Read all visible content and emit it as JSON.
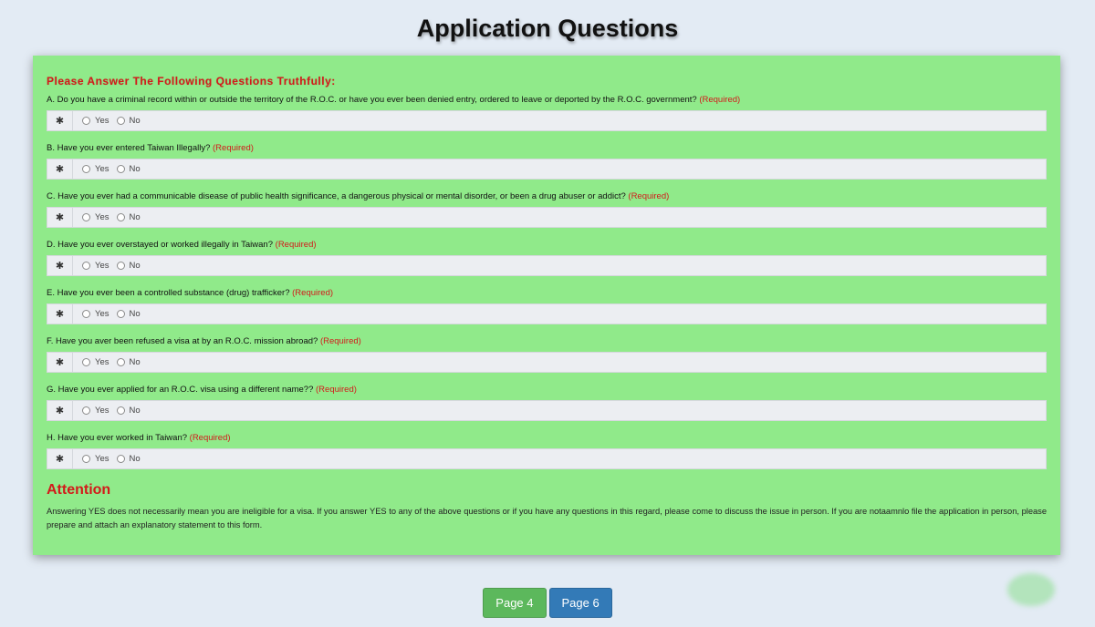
{
  "page": {
    "title": "Application Questions"
  },
  "form": {
    "intro": "Please Answer The Following Questions Truthfully:",
    "required_label": "(Required)",
    "star_glyph": "✱",
    "yes_label": "Yes",
    "no_label": "No",
    "questions": [
      {
        "text": "A. Do you have a criminal record within or outside the territory of the R.O.C. or have you ever been denied entry, ordered to leave or deported by the R.O.C. government?"
      },
      {
        "text": "B. Have you ever entered Taiwan Illegally?"
      },
      {
        "text": "C. Have you ever had a communicable disease of public health significance, a dangerous physical or mental disorder, or been a drug abuser or addict?"
      },
      {
        "text": "D. Have you ever overstayed or worked illegally in Taiwan?"
      },
      {
        "text": "E. Have you ever been a controlled substance (drug) trafficker?"
      },
      {
        "text": "F. Have you aver been refused a visa at by an R.O.C. mission abroad?"
      },
      {
        "text": "G. Have you ever applied for an R.O.C. visa using a different name??"
      },
      {
        "text": "H. Have you ever worked in Taiwan?"
      }
    ]
  },
  "attention": {
    "heading": "Attention",
    "text": "Answering YES does not necessarily mean you are ineligible for a visa. If you answer YES to any of the above questions or if you have any questions in this regard, please come to discuss the issue in person. If you are notaamnlo file the application in person, please prepare and attach an explanatory statement to this form."
  },
  "nav": {
    "prev_label": "Page 4",
    "next_label": "Page 6"
  },
  "colors": {
    "panel": "#90ea8a",
    "required": "#d31a1a",
    "prev_button": "#5cb85c",
    "next_button": "#337ab7"
  }
}
